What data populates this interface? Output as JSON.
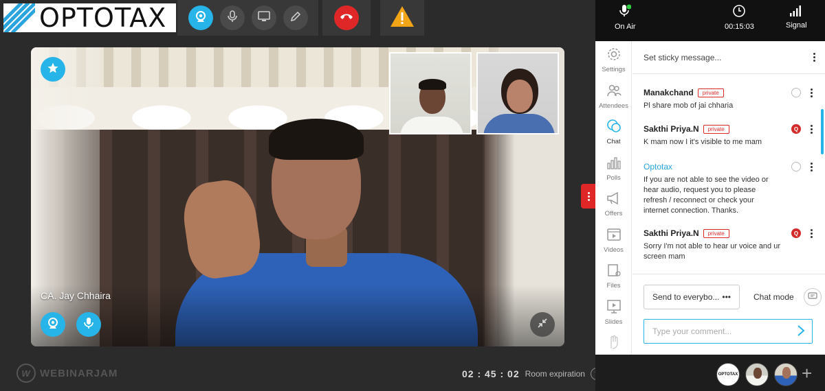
{
  "brand": {
    "logo_text": "OPTOTAX"
  },
  "toolbar": {
    "webcam_icon": "webcam-icon",
    "mic_icon": "microphone-icon",
    "screen_icon": "screen-share-icon",
    "draw_icon": "pencil-icon",
    "hangup_icon": "hangup-icon",
    "warning_icon": "warning-icon",
    "accent": "#27b4e8",
    "danger": "#e02727",
    "warning": "#f2a516"
  },
  "video": {
    "speaker_name": "CA. Jay Chhaira"
  },
  "footer": {
    "platform_name": "WEBINARJAM",
    "timer": "02 : 45 : 02",
    "timer_label": "Room expiration"
  },
  "status": {
    "on_air_label": "On Air",
    "elapsed": "00:15:03",
    "signal_label": "Signal"
  },
  "rail": [
    {
      "label": "Settings",
      "icon": "gear-icon"
    },
    {
      "label": "Attendees",
      "icon": "attendees-icon"
    },
    {
      "label": "Chat",
      "icon": "chat-icon"
    },
    {
      "label": "Polls",
      "icon": "polls-icon"
    },
    {
      "label": "Offers",
      "icon": "megaphone-icon"
    },
    {
      "label": "Videos",
      "icon": "video-icon"
    },
    {
      "label": "Files",
      "icon": "files-icon"
    },
    {
      "label": "Slides",
      "icon": "slides-icon"
    }
  ],
  "chat": {
    "sticky_placeholder": "Set sticky message...",
    "messages": [
      {
        "author": "Manakchand",
        "tag": "private",
        "text": "Pl share mob of jai chharia"
      },
      {
        "author": "Sakthi Priya.N",
        "tag": "private",
        "text": "K mam now I it's visible to me mam",
        "badge": "Q"
      },
      {
        "author": "Optotax",
        "text": "If you are not able to see the video or hear audio, request you to please refresh / reconnect or check your internet connection. Thanks."
      },
      {
        "author": "Sakthi Priya.N",
        "tag": "private",
        "text": "Sorry I'm not able to hear ur voice and ur screen mam",
        "badge": "Q"
      }
    ],
    "send_to": "Send to everybo...",
    "send_more": "•••",
    "chat_mode_label": "Chat mode",
    "comment_placeholder": "Type your comment..."
  },
  "presenters": {
    "avatar_logo_text": "OPTOTAX",
    "add_label": "+"
  }
}
